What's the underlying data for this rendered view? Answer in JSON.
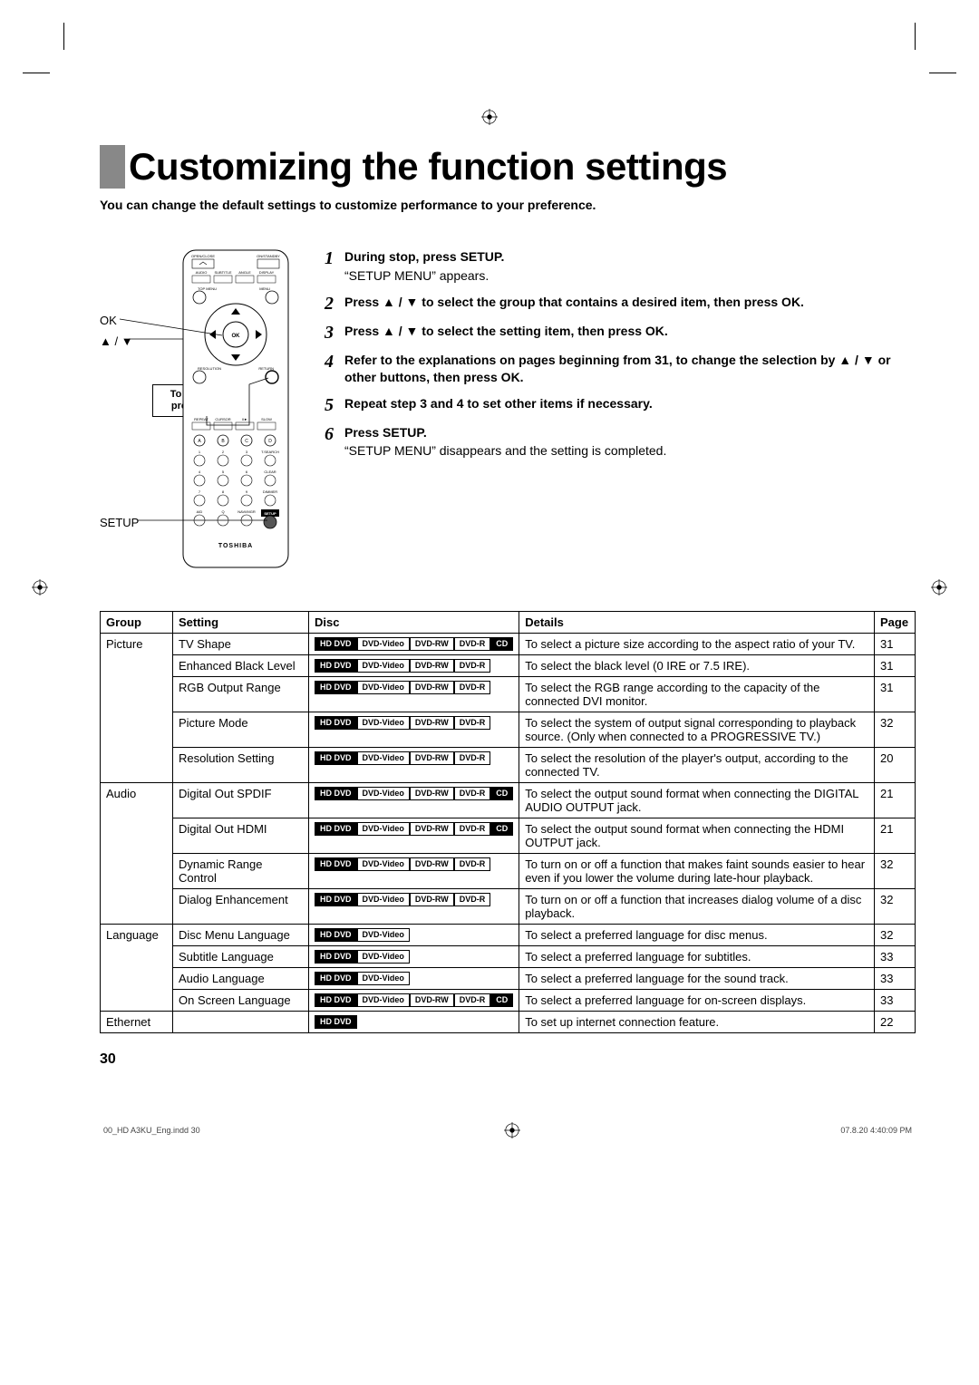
{
  "title": "Customizing the function settings",
  "intro": "You can change the default settings to customize performance to your preference.",
  "remote": {
    "label_ok": "OK",
    "label_arrows": "▲ / ▼",
    "label_setup": "SETUP",
    "return_box_line1": "To return to the",
    "return_box_line2": "previous menu",
    "brand": "TOSHIBA",
    "top_labels": {
      "open_close": "OPEN/CLOSE",
      "on_standby": "ON/STANDBY",
      "audio": "AUDIO",
      "subtitle": "SUBTITLE",
      "angle": "ANGLE",
      "display": "DISPLAY",
      "topmenu": "TOP MENU",
      "menu": "MENU",
      "resolution": "RESOLUTION",
      "ok": "OK",
      "return": "RETURN",
      "repeat": "REPEAT",
      "cursor": "CURSOR",
      "playpause": "II►",
      "slow": "SLOW",
      "tsearch": "T.SEARCH",
      "clear": "CLEAR",
      "dimmer": "DIMMER",
      "aid": "AID",
      "q": "Q",
      "navimgr": "NAVI/MGR",
      "setup": "SETUP"
    }
  },
  "steps": [
    {
      "num": "1",
      "head": "During stop, press SETUP.",
      "body": "“SETUP MENU” appears."
    },
    {
      "num": "2",
      "head": "Press ▲ / ▼ to select the group that contains a desired item, then press OK.",
      "body": ""
    },
    {
      "num": "3",
      "head": "Press ▲ / ▼ to select the setting item, then press OK.",
      "body": ""
    },
    {
      "num": "4",
      "head": "Refer to the explanations on pages beginning from 31, to change the selection by ▲ / ▼ or other buttons, then press OK.",
      "body": ""
    },
    {
      "num": "5",
      "head": "Repeat step 3 and 4 to set other items if necessary.",
      "body": ""
    },
    {
      "num": "6",
      "head": "Press SETUP.",
      "body": "“SETUP MENU” disappears and the setting is completed."
    }
  ],
  "table": {
    "headers": {
      "group": "Group",
      "setting": "Setting",
      "disc": "Disc",
      "details": "Details",
      "page": "Page"
    },
    "disc_labels": {
      "hddvd": "HD DVD",
      "dvdvideo": "DVD-Video",
      "dvdrw": "DVD-RW",
      "dvdr": "DVD-R",
      "cd": "CD"
    },
    "rows": [
      {
        "group": "Picture",
        "setting": "TV Shape",
        "discs": [
          "hddvd",
          "dvdvideo",
          "dvdrw",
          "dvdr",
          "cd"
        ],
        "details": "To select a picture size according to the aspect ratio of your TV.",
        "page": "31",
        "group_rowspan": 5
      },
      {
        "setting": "Enhanced Black Level",
        "discs": [
          "hddvd",
          "dvdvideo",
          "dvdrw",
          "dvdr"
        ],
        "details": "To select the black level (0 IRE or 7.5 IRE).",
        "page": "31"
      },
      {
        "setting": "RGB Output Range",
        "discs": [
          "hddvd",
          "dvdvideo",
          "dvdrw",
          "dvdr"
        ],
        "details": "To select the RGB range according to the capacity of the connected DVI monitor.",
        "page": "31"
      },
      {
        "setting": "Picture Mode",
        "discs": [
          "hddvd",
          "dvdvideo",
          "dvdrw",
          "dvdr"
        ],
        "details": "To select the system of output signal corresponding to playback source. (Only when connected to a PROGRESSIVE TV.)",
        "page": "32"
      },
      {
        "setting": "Resolution Setting",
        "discs": [
          "hddvd",
          "dvdvideo",
          "dvdrw",
          "dvdr"
        ],
        "details": "To select the resolution of the player's output, according to the connected TV.",
        "page": "20"
      },
      {
        "group": "Audio",
        "setting": "Digital Out SPDIF",
        "discs": [
          "hddvd",
          "dvdvideo",
          "dvdrw",
          "dvdr",
          "cd"
        ],
        "details": "To select the output sound format when connecting the DIGITAL AUDIO OUTPUT jack.",
        "page": "21",
        "group_rowspan": 4
      },
      {
        "setting": "Digital Out HDMI",
        "discs": [
          "hddvd",
          "dvdvideo",
          "dvdrw",
          "dvdr",
          "cd"
        ],
        "details": "To select the output sound format when connecting the HDMI OUTPUT jack.",
        "page": "21"
      },
      {
        "setting": "Dynamic Range Control",
        "discs": [
          "hddvd",
          "dvdvideo",
          "dvdrw",
          "dvdr"
        ],
        "details": "To turn on or off a function that makes faint sounds easier to hear even if you lower the volume during late-hour playback.",
        "page": "32"
      },
      {
        "setting": "Dialog Enhancement",
        "discs": [
          "hddvd",
          "dvdvideo",
          "dvdrw",
          "dvdr"
        ],
        "details": "To turn on or off a function that increases dialog volume of a disc playback.",
        "page": "32"
      },
      {
        "group": "Language",
        "setting": "Disc Menu Language",
        "discs": [
          "hddvd",
          "dvdvideo"
        ],
        "details": "To select a preferred language for disc menus.",
        "page": "32",
        "group_rowspan": 4
      },
      {
        "setting": "Subtitle Language",
        "discs": [
          "hddvd",
          "dvdvideo"
        ],
        "details": "To select a preferred language for subtitles.",
        "page": "33"
      },
      {
        "setting": "Audio Language",
        "discs": [
          "hddvd",
          "dvdvideo"
        ],
        "details": "To select a preferred language for the sound track.",
        "page": "33"
      },
      {
        "setting": "On Screen Language",
        "discs": [
          "hddvd",
          "dvdvideo",
          "dvdrw",
          "dvdr",
          "cd"
        ],
        "details": "To select a preferred language for on-screen displays.",
        "page": "33"
      },
      {
        "group": "Ethernet",
        "setting": "",
        "discs": [
          "hddvd"
        ],
        "details": "To set up internet connection feature.",
        "page": "22",
        "group_rowspan": 1
      }
    ]
  },
  "page_number": "30",
  "footer": {
    "left": "00_HD A3KU_Eng.indd   30",
    "right": "07.8.20   4:40:09 PM"
  }
}
